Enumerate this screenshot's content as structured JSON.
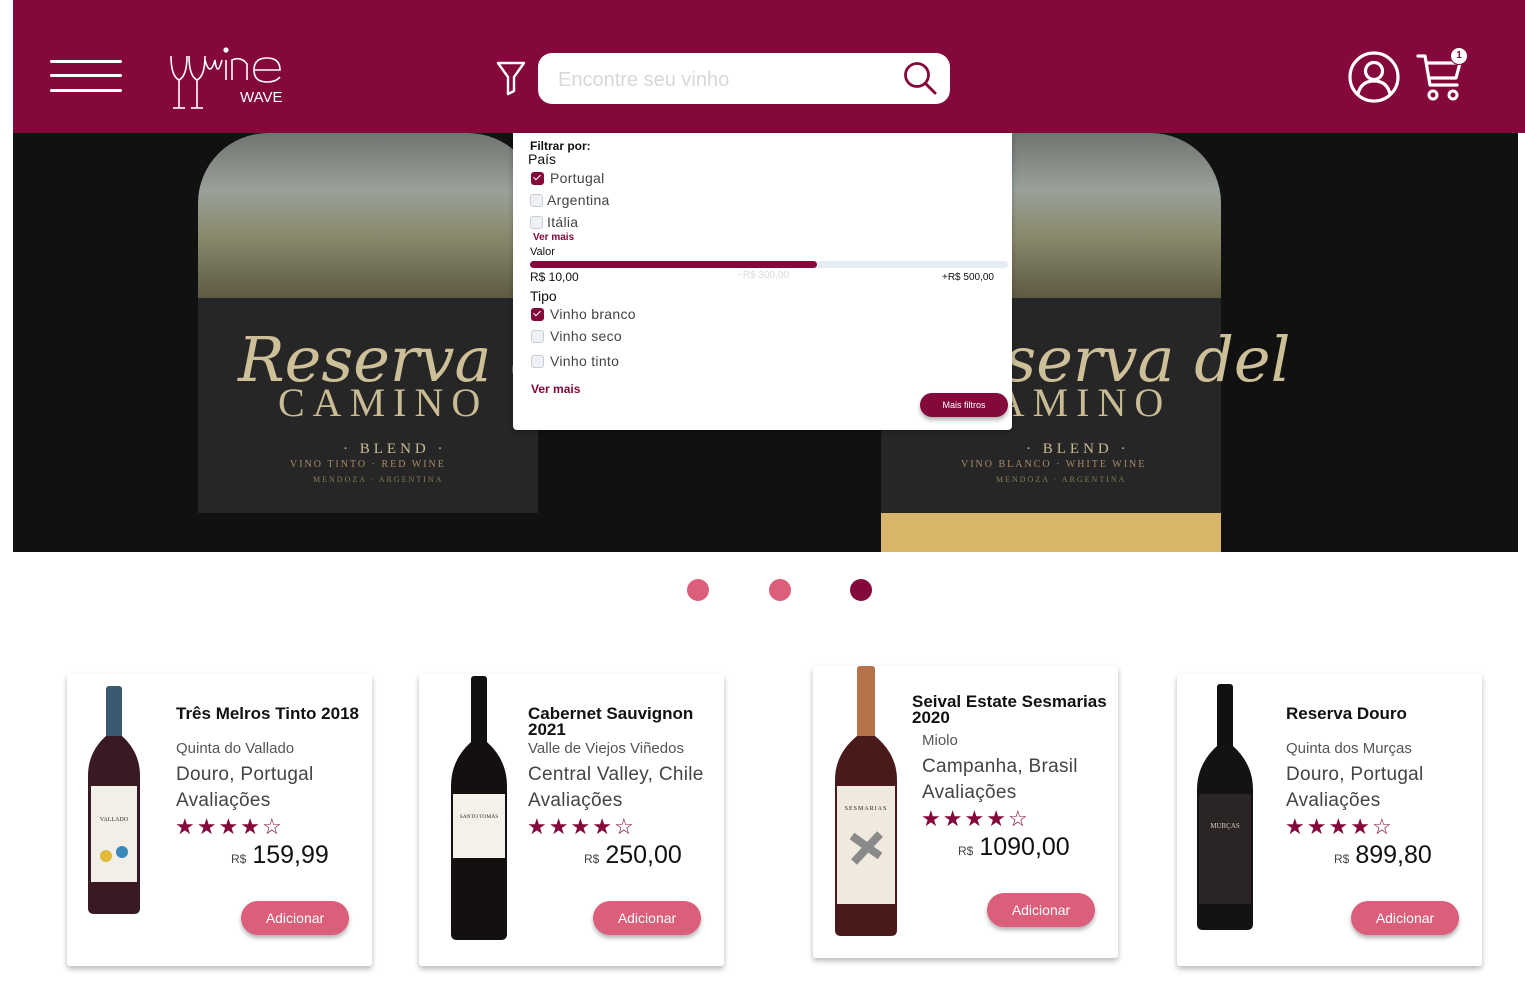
{
  "header": {
    "logo_text": "wine",
    "logo_sub": "WAVE",
    "search_placeholder": "Encontre seu vinho",
    "cart_count": "1"
  },
  "hero": {
    "bottles": [
      {
        "script": "Reserva del",
        "name": "CAMINO",
        "blend": "· BLEND ·",
        "sub": "VINO TINTO · RED WINE",
        "origin": "MENDOZA · ARGENTINA"
      },
      {
        "script": "Reserva del",
        "name": "CAMINO",
        "blend": "· BLEND ·",
        "sub": "VINO BLANCO · WHITE WINE",
        "origin": "MENDOZA · ARGENTINA"
      }
    ]
  },
  "filter": {
    "title": "Filtrar por:",
    "country_label": "País",
    "countries": [
      {
        "label": "Portugal",
        "checked": true
      },
      {
        "label": "Argentina",
        "checked": false
      },
      {
        "label": "Itália",
        "checked": false
      }
    ],
    "ver_mais_1": "Ver mais",
    "value_label": "Valor",
    "range_min": "R$ 10,00",
    "range_mid": "~R$ 300,00",
    "range_max": "+R$ 500,00",
    "range_fill": 0.6,
    "type_label": "Tipo",
    "types": [
      {
        "label": "Vinho branco",
        "checked": true
      },
      {
        "label": "Vinho seco",
        "checked": false
      },
      {
        "label": "Vinho tinto",
        "checked": false
      }
    ],
    "ver_mais_2": "Ver mais",
    "more_filters": "Mais filtros"
  },
  "carousel": {
    "count": 3,
    "active": 2
  },
  "products": [
    {
      "name": "Três Melros Tinto 2018",
      "producer": "Quinta do Vallado",
      "region": "Douro, Portugal",
      "ratings_label": "Avaliações",
      "rating": 4,
      "currency": "R$",
      "price": "159,99",
      "button": "Adicionar",
      "bottle_label": "VALLADO"
    },
    {
      "name": "Cabernet Sauvignon 2021",
      "producer": "Valle de Viejos Viñedos",
      "region": "Central Valley, Chile",
      "ratings_label": "Avaliações",
      "rating": 4,
      "currency": "R$",
      "price": "250,00",
      "button": "Adicionar",
      "bottle_label": "SANTO TOMÁS"
    },
    {
      "name": "Seival Estate Sesmarias 2020",
      "producer": "Miolo",
      "region": "Campanha, Brasil",
      "ratings_label": "Avaliações",
      "rating": 4,
      "currency": "R$",
      "price": "1090,00",
      "button": "Adicionar",
      "bottle_label": "SESMARIAS"
    },
    {
      "name": "Reserva Douro",
      "producer": "Quinta dos Murças",
      "region": "Douro, Portugal",
      "ratings_label": "Avaliações",
      "rating": 4,
      "currency": "R$",
      "price": "899,80",
      "button": "Adicionar",
      "bottle_label": "MURÇAS"
    }
  ],
  "colors": {
    "brand": "#84083b",
    "accent": "#db5e7a"
  }
}
